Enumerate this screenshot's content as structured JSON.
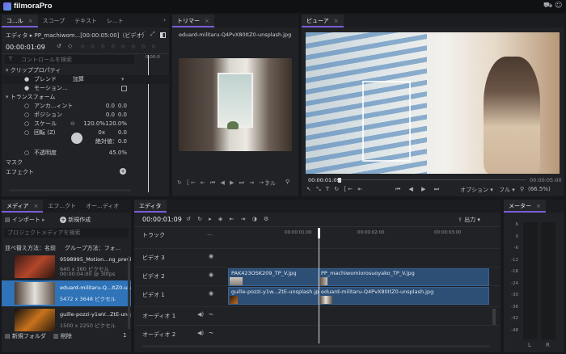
{
  "app": {
    "title": "filmoraPro"
  },
  "controls": {
    "tabs": [
      "コ...ル",
      "スコープ",
      "テキスト",
      "レ...ト"
    ],
    "editor_title": "エディタ ▸ PP_machiwom...[00:00:05:00]（ビデオ）",
    "timecode": "00:00:01:09",
    "ruler_time": "0:00:0",
    "search_placeholder": "コントロールを検索",
    "clip_props": "クリッププロパティ",
    "blend_label": "ブレンド",
    "blend_value": "加算",
    "motion_label": "モーション...",
    "transform_label": "トランスフォーム",
    "anchor_label": "アンカ...ィント",
    "anchor_x": "0.0",
    "anchor_y": "0.0",
    "position_label": "ポジション",
    "position_x": "0.0",
    "position_y": "0.0",
    "scale_label": "スケール",
    "scale_x": "120.0%",
    "scale_y": "120.0%",
    "rotation_label": "回転 (Z)",
    "rotation_turns": "0x",
    "rotation_deg": "0.0",
    "absolute_label": "絶対値：0.0",
    "opacity_label": "不透明度",
    "opacity_value": "45.0%",
    "mask_label": "マスク",
    "effects_label": "エフェクト"
  },
  "trimmer": {
    "tab": "トリマー",
    "filename": "eduard-militaru-Q4PvX80ItZ0-unsplash.jpg",
    "fit_label": "フル"
  },
  "viewer": {
    "tab": "ビューア",
    "timecode": "00:00:01:09",
    "end_timecode": "00:00:05:00",
    "options_label": "オプション",
    "full_label": "フル",
    "zoom": "(66.5%)"
  },
  "media": {
    "tabs": [
      "メディア",
      "エフ...クト",
      "オー...ディオ"
    ],
    "import_label": "インポート",
    "new_comp_label": "新規作成",
    "search_placeholder": "プロジェクトメディアを検索",
    "sort_label": "並べ替え方法：名前",
    "group_label": "グループ方法：フォ...",
    "items": [
      {
        "name": "9598995_Motion...ng_preview",
        "dims": "640 x 360 ピクセル",
        "meta": "00:00:04:00 @ 30fps"
      },
      {
        "name": "eduard-militaru-Q...ItZ0-unsplash.jpg",
        "dims": "5472 x 3648 ピクセル",
        "meta": ""
      },
      {
        "name": "guille-pozzi-y1wV...ZtE-unsplash.jpg",
        "dims": "1500 x 2250 ピクセル",
        "meta": ""
      }
    ],
    "new_folder_label": "新規フォルダ",
    "delete_label": "削除",
    "count": "1"
  },
  "editor": {
    "tab": "エディタ",
    "timecode": "00:00:01:09",
    "export_label": "出力",
    "track_header": "トラック",
    "ruler": [
      "00:00:01:00",
      "00:00:02:00",
      "00:00:03:00"
    ],
    "tracks": [
      "ビデオ 3",
      "ビデオ 2",
      "ビデオ 1",
      "オーディオ 1",
      "オーディオ 2"
    ],
    "clips": {
      "v2a": "PAK423OSK209_TP_V.jpg",
      "v2b": "PP_machiwomiorosuoyako_TP_V.jpg",
      "v1a": "guille-pozzi-y1w...ZtE-unsplash.jpg",
      "v1b": "eduard-militaru-Q4PvX80ItZ0-unsplash.jpg"
    }
  },
  "meter": {
    "tab": "メーター",
    "scale": [
      "6",
      "0",
      "-6",
      "-12",
      "-18",
      "-24",
      "-30",
      "-36",
      "-42",
      "-48"
    ],
    "left": "L",
    "right": "R"
  }
}
